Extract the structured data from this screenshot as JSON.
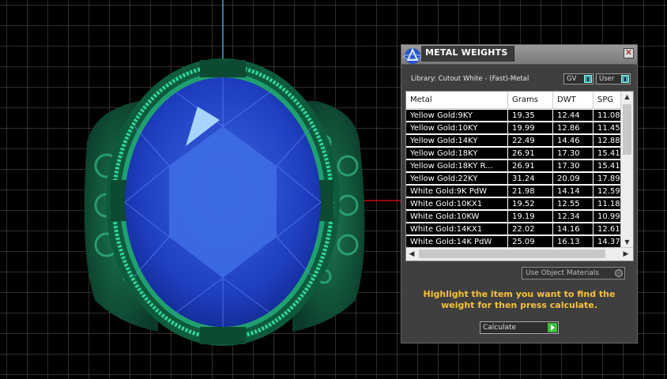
{
  "panel": {
    "title": "METAL WEIGHTS",
    "close_icon": "x-icon",
    "library_label": "Library: Cutout White - (Fast)-Metal",
    "toggle_gv": "GV",
    "toggle_user": "User",
    "table": {
      "headers": [
        "Metal",
        "Grams",
        "DWT",
        "SPG"
      ],
      "rows": [
        [
          "Yellow Gold:9KY",
          "19.35",
          "12.44",
          "11.08"
        ],
        [
          "Yellow Gold:10KY",
          "19.99",
          "12.86",
          "11.45"
        ],
        [
          "Yellow Gold:14KY",
          "22.49",
          "14.46",
          "12.88"
        ],
        [
          "Yellow Gold:18KY",
          "26.91",
          "17.30",
          "15.41"
        ],
        [
          "Yellow Gold:18KY R...",
          "26.91",
          "17.30",
          "15.41"
        ],
        [
          "Yellow Gold:22KY",
          "31.24",
          "20.09",
          "17.89"
        ],
        [
          "White Gold:9K PdW",
          "21.98",
          "14.14",
          "12.59"
        ],
        [
          "White Gold:10KX1",
          "19.52",
          "12.55",
          "11.18"
        ],
        [
          "White Gold:10KW",
          "19.19",
          "12.34",
          "10.99"
        ],
        [
          "White Gold:14KX1",
          "22.02",
          "14.16",
          "12.61"
        ],
        [
          "White Gold:14K PdW",
          "25.09",
          "16.13",
          "14.37"
        ]
      ]
    },
    "use_object_materials": "Use Object Materials",
    "instructions": "Highlight the item you want to find the weight for then press calculate.",
    "calculate_label": "Calculate"
  },
  "colors": {
    "grid": "#5a5a5a",
    "gem": "#2a4fd0",
    "metal": "#1f9a6a",
    "accent": "#f7c23b"
  }
}
